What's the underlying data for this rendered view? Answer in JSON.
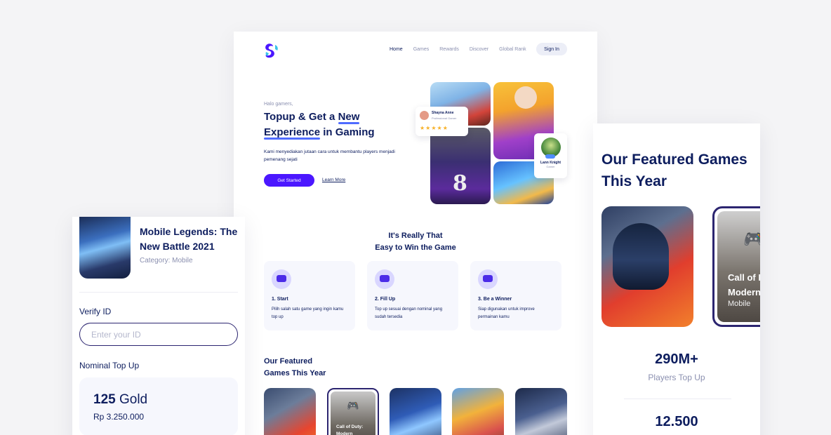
{
  "nav": {
    "items": [
      "Home",
      "Games",
      "Rewards",
      "Discover",
      "Global Rank"
    ],
    "signin_label": "Sign In"
  },
  "hero": {
    "greeting": "Halo gamers,",
    "title_part1": "Topup & Get a ",
    "title_highlight1": "New",
    "title_highlight2": "Experience",
    "title_part2": " in Gaming",
    "description": "Kami menyediakan jutaan cara untuk membantu players menjadi pemenang sejati",
    "primary_label": "Get Started",
    "secondary_label": "Learn More",
    "review_card": {
      "name": "Shayna Anne",
      "role": "Professional Gamer",
      "stars": "★★★★★",
      "rating": 5
    },
    "player_card": {
      "name": "Lann Knight",
      "role": "Gamer"
    },
    "jersey_number": "8"
  },
  "steps": {
    "title_line1": "It's Really That",
    "title_line2": "Easy to Win the Game",
    "items": [
      {
        "title": "1. Start",
        "desc": "Pilih salah satu game yang ingin kamu top up"
      },
      {
        "title": "2. Fill Up",
        "desc": "Top up sesuai dengan nominal yang sudah tersedia"
      },
      {
        "title": "3. Be a Winner",
        "desc": "Siap digunakan untuk improve permainan kamu"
      }
    ]
  },
  "featured": {
    "title_line1": "Our Featured",
    "title_line2": "Games This Year",
    "cod_label": "Call of Duty: Modern",
    "cod_category": "Mobile"
  },
  "purchase": {
    "game_title": "Mobile Legends: The New Battle 2021",
    "category": "Category: Mobile",
    "verify_label": "Verify ID",
    "id_placeholder": "Enter your ID",
    "nominal_label": "Nominal Top Up",
    "nominal_amount": "125",
    "nominal_unit": "Gold",
    "nominal_price": "Rp 3.250.000"
  },
  "right_panel": {
    "title": "Our Featured Games This Year",
    "card_label_line1": "Call of D",
    "card_label_line2": "Modern",
    "card_category": "Mobile",
    "stat1_value": "290M+",
    "stat1_label": "Players Top Up",
    "stat2_value": "12.500"
  },
  "colors": {
    "navy": "#0d1d5e",
    "primary": "#4b17ff",
    "muted": "#8b90b0",
    "card_bg": "#f6f7fd",
    "star": "#f7b128"
  },
  "icons": [
    "logo-icon",
    "gamepad-icon",
    "star-icon",
    "start-step-icon",
    "fillup-step-icon",
    "winner-step-icon"
  ]
}
